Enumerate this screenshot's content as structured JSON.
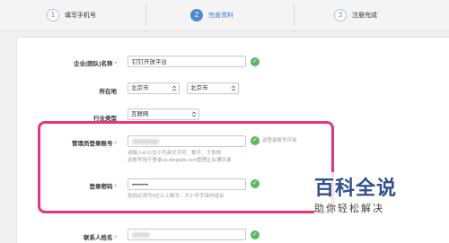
{
  "steps": [
    {
      "num": "1",
      "label": "填写手机号"
    },
    {
      "num": "2",
      "label": "完善资料"
    },
    {
      "num": "3",
      "label": "注册完成"
    }
  ],
  "form": {
    "company": {
      "label": "企业(团队)名称",
      "value": "钉钉开放平台"
    },
    "location": {
      "label": "所在地",
      "province": "北京市",
      "city": "北京市"
    },
    "industry": {
      "label": "行业类型",
      "value": "互联网"
    },
    "admin_account": {
      "label": "管理员登录账号",
      "ok_text": "该登录账号可用",
      "hint_line1": "请输入4-11位小写英文字符、数字、下划线",
      "hint_line2": "此账号用于登录oa.dingtalk.com管理企业通讯录"
    },
    "password": {
      "label": "登录密码",
      "value": "••••••••",
      "hint": "密码必须为6位以上数字、大小写字母的组合"
    },
    "contact": {
      "label": "联系人姓名"
    }
  },
  "watermark": {
    "title": "百科全说",
    "subtitle": "助你轻松解决"
  },
  "colors": {
    "highlight": "#e8357a",
    "ok": "#5cb85c",
    "active_step": "#4b8bd0"
  }
}
